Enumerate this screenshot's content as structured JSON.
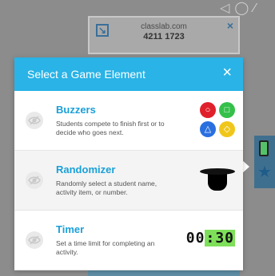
{
  "background": {
    "class_card": {
      "site": "classlab.com",
      "code": "4211 1723"
    }
  },
  "dialog": {
    "title": "Select a Game Element",
    "close_symbol": "×",
    "options": [
      {
        "title": "Buzzers",
        "description": "Students compete to finish first or to decide who goes next.",
        "art": "buzzer-buttons",
        "buzzer_symbols": [
          "○",
          "□",
          "△",
          "◇"
        ]
      },
      {
        "title": "Randomizer",
        "description": "Randomly select a student name, activity item, or number.",
        "art": "top-hat"
      },
      {
        "title": "Timer",
        "description": "Set a time limit for completing an activity.",
        "art": "timer-display",
        "timer_prefix": "00",
        "timer_highlight": ":30"
      }
    ]
  },
  "colors": {
    "header_blue": "#29b3e6",
    "title_blue": "#1aa0d8"
  }
}
